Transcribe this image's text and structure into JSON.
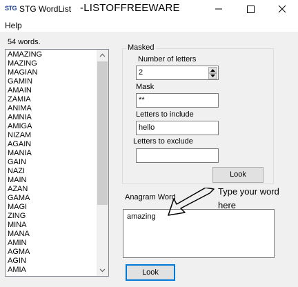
{
  "window": {
    "icon_label": "STG",
    "title": "STG WordList",
    "watermark": "-LISTOFFREEWARE"
  },
  "menu": {
    "help": "Help"
  },
  "word_count": "54 words.",
  "words": [
    "AMAZING",
    "MAZING",
    "MAGIAN",
    "GAMIN",
    "AMAIN",
    "ZAMIA",
    "ANIMA",
    "AMNIA",
    "AMIGA",
    "NIZAM",
    "AGAIN",
    "MANIA",
    "GAIN",
    "NAZI",
    "MAIN",
    "AZAN",
    "GAMA",
    "MAGI",
    "ZING",
    "MINA",
    "MANA",
    "AMIN",
    "AGMA",
    "AGIN",
    "AMIA"
  ],
  "masked": {
    "title": "Masked",
    "num_letters_label": "Number of letters",
    "num_letters_value": "2",
    "mask_label": "Mask",
    "mask_value": "**",
    "include_label": "Letters to include",
    "include_value": "hello",
    "exclude_label": "Letters to exclude",
    "exclude_value": "",
    "look_label": "Look"
  },
  "anagram": {
    "label": "Anagram Word",
    "value": "amazing",
    "look_label": "Look"
  },
  "annotation": "Type your word here"
}
